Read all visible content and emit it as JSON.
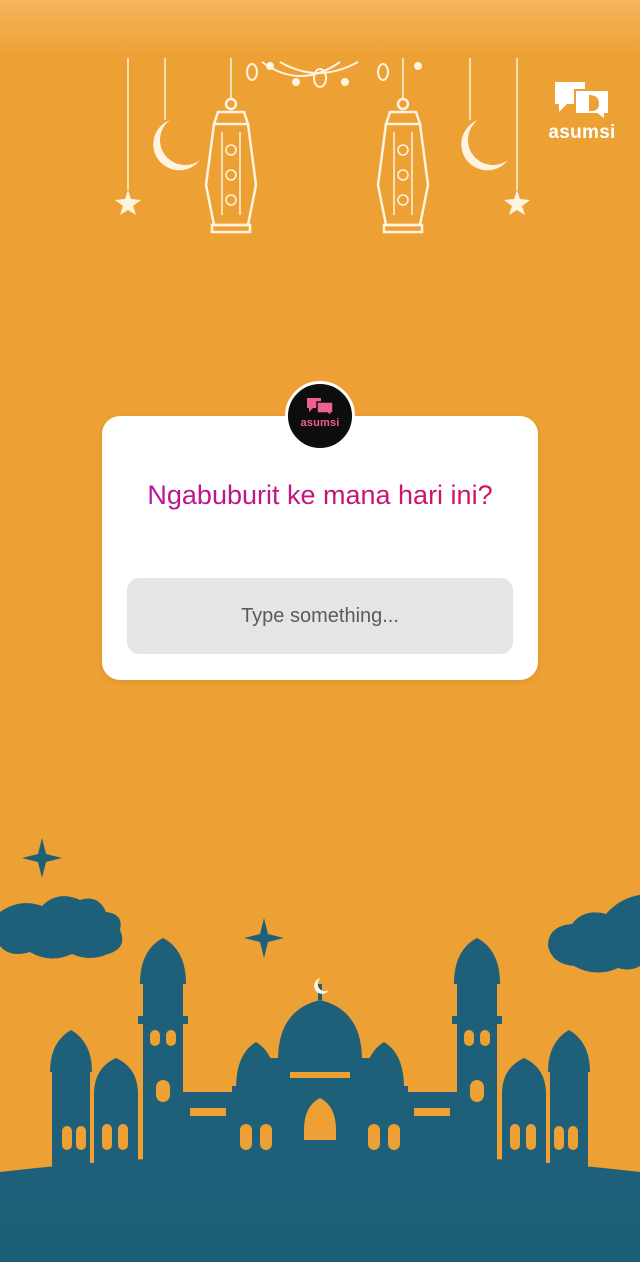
{
  "brand": {
    "name": "asumsi"
  },
  "question_sticker": {
    "avatar_label": "asumsi",
    "question": "Ngabuburit ke mana hari ini?",
    "answer_placeholder": "Type something..."
  },
  "colors": {
    "background": "#EDA033",
    "silhouette": "#1E6079",
    "decoration": "#FFF4E0",
    "question_gradient_start": "#B5179E",
    "question_gradient_end": "#D4145A",
    "avatar_bg": "#0D0D0D",
    "avatar_accent": "#F0608F"
  },
  "decor": {
    "top": [
      "moon-icon",
      "star-icon",
      "lantern-icon"
    ],
    "bottom": [
      "mosque-silhouette",
      "cloud-icon",
      "sparkle-icon",
      "crescent-icon"
    ]
  }
}
